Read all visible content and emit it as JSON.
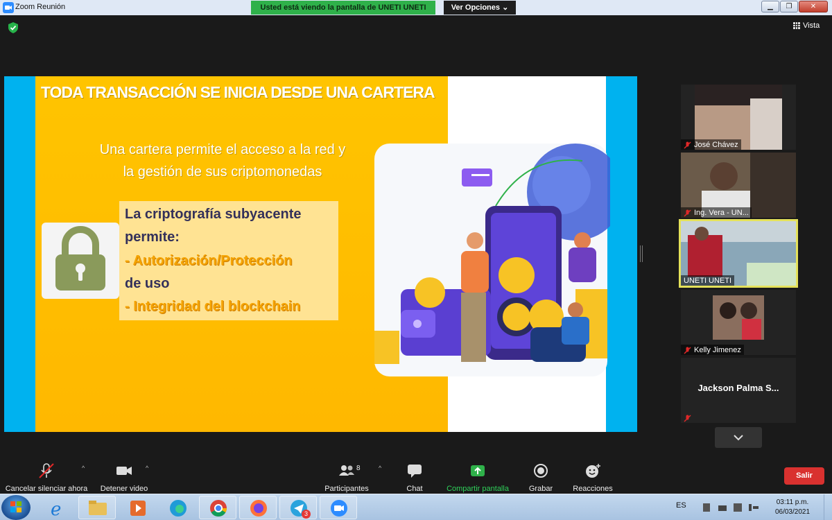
{
  "window": {
    "title": "Zoom Reunión",
    "share_banner": "Usted está viendo la pantalla de UNETI UNETI",
    "view_options": "Ver Opciones",
    "view_label": "Vista"
  },
  "slide": {
    "title": "TODA TRANSACCIÓN SE INICIA DESDE UNA CARTERA",
    "subtitle_line1": "Una cartera permite el acceso a la red y",
    "subtitle_line2": "la gestión de sus criptomonedas",
    "box_line1": "La criptografía subyacente",
    "box_line2": "permite:",
    "box_line3": "- Autorización/Protección",
    "box_line4": "de uso",
    "box_line5": "- Integridad del blockchain"
  },
  "participants": [
    {
      "name": "José Chávez",
      "muted": true
    },
    {
      "name": "Ing. Vera - UN...",
      "muted": true
    },
    {
      "name": "UNETI UNETI",
      "muted": false,
      "active": true
    },
    {
      "name": "Kelly Jimenez",
      "muted": true
    },
    {
      "name": "Jackson Palma S...",
      "muted": true,
      "video": false
    }
  ],
  "toolbar": {
    "unmute": "Cancelar silenciar ahora",
    "stop_video": "Detener video",
    "participants": "Participantes",
    "participants_count": "8",
    "chat": "Chat",
    "share": "Compartir pantalla",
    "record": "Grabar",
    "reactions": "Reacciones",
    "leave": "Salir"
  },
  "taskbar": {
    "language": "ES",
    "time": "03:11 p.m.",
    "date": "06/03/2021",
    "telegram_badge": "3"
  },
  "colors": {
    "share_green": "#2fb14a",
    "slide_yellow": "#ffc400",
    "slide_blue": "#00b2ef",
    "leave_red": "#d9312f",
    "active_border": "#e4e15a"
  }
}
